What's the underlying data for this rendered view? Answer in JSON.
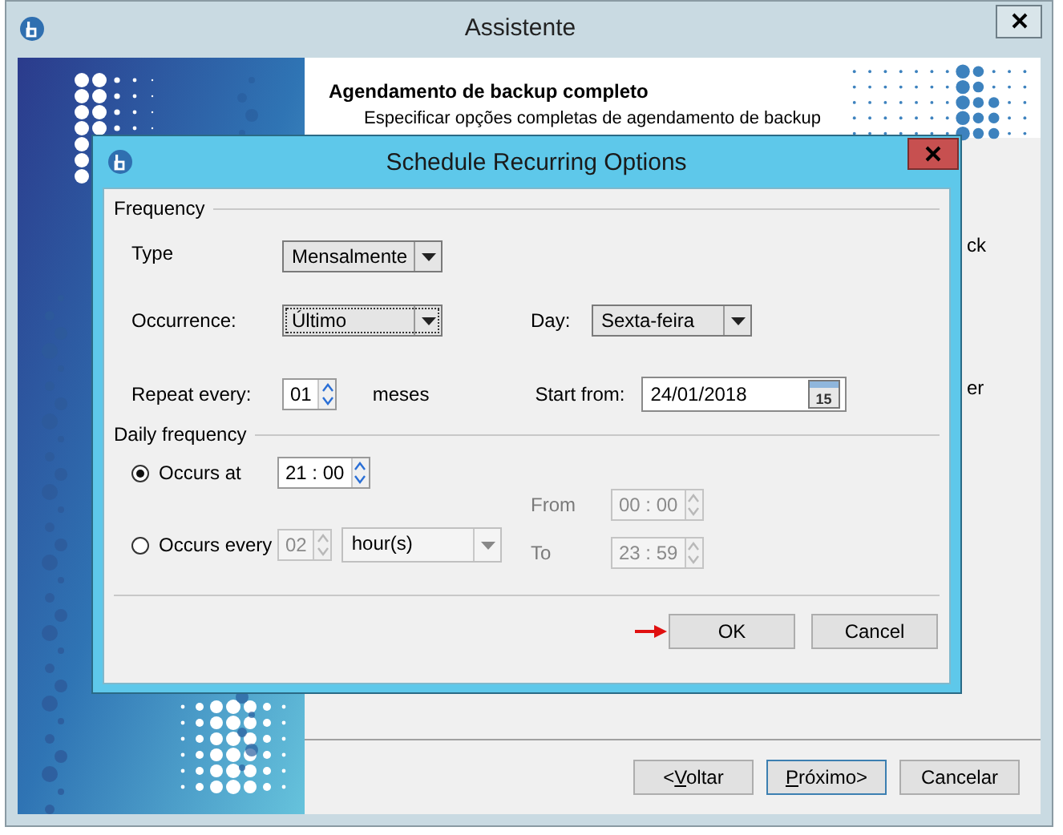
{
  "window": {
    "title": "Assistente"
  },
  "header": {
    "title": "Agendamento de backup completo",
    "subtitle": "Especificar opções completas de agendamento de backup"
  },
  "background_fragments": [
    "ck",
    "er"
  ],
  "wizard_buttons": [
    {
      "label_before": "<",
      "label_mnemonic": "V",
      "label_after": "oltar",
      "default": false
    },
    {
      "label_mnemonic": "P",
      "label_after": "róximo>",
      "default": true
    },
    {
      "label_before": "Cancelar",
      "default": false
    }
  ],
  "dialog": {
    "title": "Schedule Recurring Options",
    "frequency": {
      "heading": "Frequency",
      "type_label": "Type",
      "type_value": "Mensalmente",
      "occurrence_label": "Occurrence:",
      "occurrence_value": "Último",
      "occurrence_focused": true,
      "day_label": "Day:",
      "day_value": "Sexta-feira",
      "repeat_label": "Repeat every:",
      "repeat_value": "01",
      "repeat_unit": "meses",
      "start_label": "Start from:",
      "start_value": "24/01/2018",
      "calendar_day": "15"
    },
    "daily": {
      "heading": "Daily frequency",
      "options": [
        {
          "label": "Occurs at",
          "selected": true
        },
        {
          "label": "Occurs every",
          "selected": false
        }
      ],
      "at_time": {
        "hours": "21",
        "separator": ":",
        "minutes": "00"
      },
      "every_value": "02",
      "every_unit": "hour(s)",
      "from_label": "From",
      "from_time": {
        "hours": "00",
        "separator": ":",
        "minutes": "00"
      },
      "to_label": "To",
      "to_time": {
        "hours": "23",
        "separator": ":",
        "minutes": "59"
      }
    },
    "buttons": [
      {
        "label": "OK"
      },
      {
        "label": "Cancel"
      }
    ]
  }
}
